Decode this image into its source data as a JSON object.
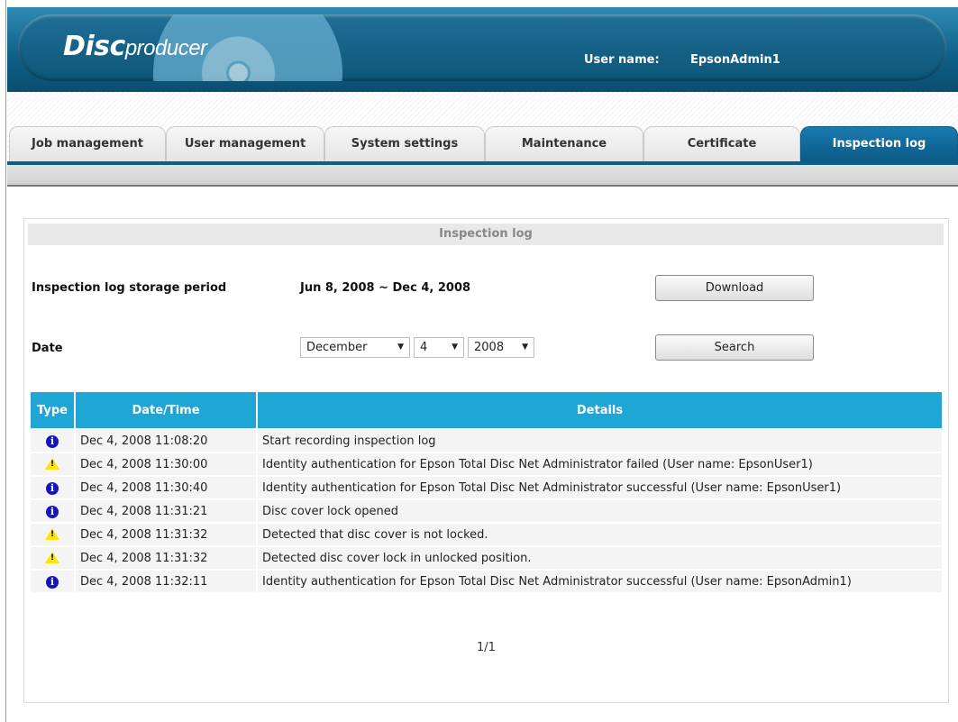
{
  "header": {
    "logo_part1": "Disc",
    "logo_part2": "producer",
    "user_label": "User name:",
    "user_value": "EpsonAdmin1"
  },
  "tabs": [
    {
      "label": "Job management",
      "active": false
    },
    {
      "label": "User management",
      "active": false
    },
    {
      "label": "System settings",
      "active": false
    },
    {
      "label": "Maintenance",
      "active": false
    },
    {
      "label": "Certificate",
      "active": false
    },
    {
      "label": "Inspection log",
      "active": true
    }
  ],
  "panel": {
    "title": "Inspection log",
    "storage_label": "Inspection log storage period",
    "storage_value": "Jun 8, 2008 ~ Dec 4, 2008",
    "download_label": "Download",
    "date_label": "Date",
    "month": "December",
    "day": "4",
    "year": "2008",
    "search_label": "Search"
  },
  "table": {
    "headers": [
      "Type",
      "Date/Time",
      "Details"
    ],
    "rows": [
      {
        "type": "info",
        "datetime": "Dec 4, 2008 11:08:20",
        "details": "Start recording inspection log"
      },
      {
        "type": "warning",
        "datetime": "Dec 4, 2008 11:30:00",
        "details": "Identity authentication for Epson Total Disc Net Administrator failed (User name: EpsonUser1)"
      },
      {
        "type": "info",
        "datetime": "Dec 4, 2008 11:30:40",
        "details": "Identity authentication for Epson Total Disc Net Administrator successful (User name: EpsonUser1)"
      },
      {
        "type": "info",
        "datetime": "Dec 4, 2008 11:31:21",
        "details": "Disc cover lock opened"
      },
      {
        "type": "warning",
        "datetime": "Dec 4, 2008 11:31:32",
        "details": "Detected that disc cover is not locked."
      },
      {
        "type": "warning",
        "datetime": "Dec 4, 2008 11:31:32",
        "details": "Detected disc cover lock in unlocked position."
      },
      {
        "type": "info",
        "datetime": "Dec 4, 2008 11:32:11",
        "details": "Identity authentication for Epson Total Disc Net Administrator successful (User name: EpsonAdmin1)"
      }
    ]
  },
  "pager": "1/1",
  "colors": {
    "header_blue": "#0f5f86",
    "table_header": "#1fa6d4",
    "info_icon": "#1414c0",
    "warning_icon": "#ffe600"
  }
}
